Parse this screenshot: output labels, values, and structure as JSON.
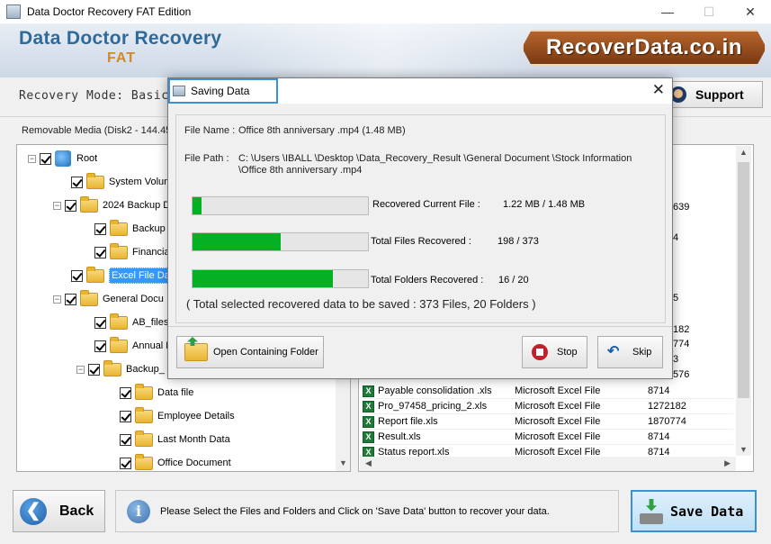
{
  "window": {
    "title": "Data Doctor Recovery FAT Edition",
    "minimize": "—",
    "maximize": "☐",
    "close": "✕"
  },
  "banner": {
    "brand": "Data Doctor Recovery",
    "edition": "FAT",
    "logo": "RecoverData.co.in"
  },
  "modebar": {
    "mode": "Recovery Mode: Basic",
    "support": "Support"
  },
  "tree": {
    "media_label": "Removable Media (Disk2 - 144.45",
    "items": [
      {
        "label": "Root",
        "type": "drive",
        "expander": "−"
      },
      {
        "label": "System Volum",
        "type": "folder",
        "expander": ""
      },
      {
        "label": "2024 Backup D",
        "type": "folder",
        "expander": "−"
      },
      {
        "label": "Backup d",
        "type": "folder",
        "expander": ""
      },
      {
        "label": "Financial",
        "type": "folder",
        "expander": ""
      },
      {
        "label": "Excel File Data",
        "type": "folder",
        "expander": "",
        "selected": true
      },
      {
        "label": "General Docu",
        "type": "folder",
        "expander": "−"
      },
      {
        "label": "AB_files",
        "type": "folder",
        "expander": ""
      },
      {
        "label": "Annual R",
        "type": "folder",
        "expander": ""
      },
      {
        "label": "Backup_",
        "type": "folder",
        "expander": "−"
      },
      {
        "label": "Data file",
        "type": "folder",
        "expander": ""
      },
      {
        "label": "Employee Details",
        "type": "folder",
        "expander": ""
      },
      {
        "label": "Last Month Data",
        "type": "folder",
        "expander": ""
      },
      {
        "label": "Office Document",
        "type": "folder",
        "expander": ""
      }
    ]
  },
  "list": {
    "partial_values": [
      "639",
      "4",
      "5",
      "182",
      "774",
      "3",
      "576"
    ],
    "rows": [
      {
        "name": "Payable consolidation .xls",
        "type": "Microsoft Excel File",
        "size": "8714"
      },
      {
        "name": "Pro_97458_pricing_2.xls",
        "type": "Microsoft Excel File",
        "size": "1272182"
      },
      {
        "name": "Report file.xls",
        "type": "Microsoft Excel File",
        "size": "1870774"
      },
      {
        "name": "Result.xls",
        "type": "Microsoft Excel File",
        "size": "8714"
      },
      {
        "name": "Status report.xls",
        "type": "Microsoft Excel File",
        "size": "8714"
      }
    ]
  },
  "bottom": {
    "back": "Back",
    "info": "Please Select the Files and Folders and Click on 'Save Data' button to recover your data.",
    "save": "Save Data"
  },
  "modal": {
    "title": "Saving Data",
    "close": "✕",
    "file_name_label": "File Name :",
    "file_name_value": "Office 8th anniversary .mp4 (1.48 MB)",
    "file_path_label": "File Path :",
    "file_path_value": "C: \\Users \\IBALL \\Desktop \\Data_Recovery_Result \\General Document \\Stock Information \\Office 8th anniversary .mp4",
    "progress": [
      {
        "label": "Recovered Current File :",
        "value": "1.22 MB /   1.48 MB",
        "fraction": 0.05
      },
      {
        "label": "Total Files Recovered :",
        "value": "198 / 373",
        "fraction": 0.5
      },
      {
        "label": "Total Folders Recovered :",
        "value": "16 / 20",
        "fraction": 0.8
      }
    ],
    "summary": "( Total selected recovered data to be saved : 373 Files, 20 Folders )",
    "buttons": {
      "open_folder": "Open Containing Folder",
      "stop": "Stop",
      "skip": "Skip"
    }
  }
}
